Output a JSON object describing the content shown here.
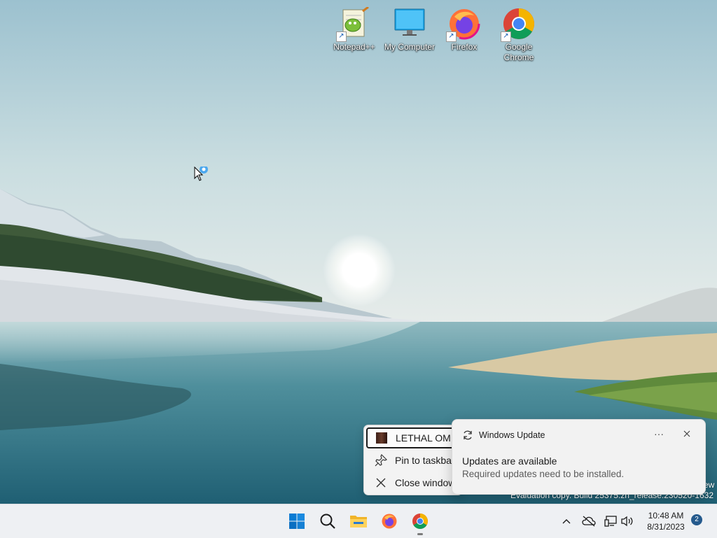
{
  "desktop": {
    "icons": [
      {
        "label": "Notepad++",
        "icon": "notepad-plus-plus-icon"
      },
      {
        "label": "My Computer",
        "icon": "monitor-icon"
      },
      {
        "label": "Firefox",
        "icon": "firefox-icon"
      },
      {
        "label": "Google Chrome",
        "icon": "chrome-icon"
      }
    ]
  },
  "jumplist": {
    "items": [
      {
        "label": "LETHAL OMEGA",
        "icon": "app-thumbnail-icon"
      },
      {
        "label": "Pin to taskbar",
        "icon": "pin-icon"
      },
      {
        "label": "Close window",
        "icon": "close-icon"
      }
    ]
  },
  "toast": {
    "app": "Windows Update",
    "more": "···",
    "title": "Updates are available",
    "body": "Required updates need to be installed."
  },
  "watermark": {
    "line1": "ew",
    "line2": "Evaluation copy. Build 25375.zn_release.230520-1632"
  },
  "taskbar": {
    "apps": [
      "start-icon",
      "search-icon",
      "file-explorer-icon",
      "firefox-icon",
      "chrome-icon"
    ],
    "time": "10:48 AM",
    "date": "8/31/2023",
    "notification_count": "2"
  },
  "colors": {
    "accent": "#0067c0",
    "taskbar": "#eef0f3"
  }
}
